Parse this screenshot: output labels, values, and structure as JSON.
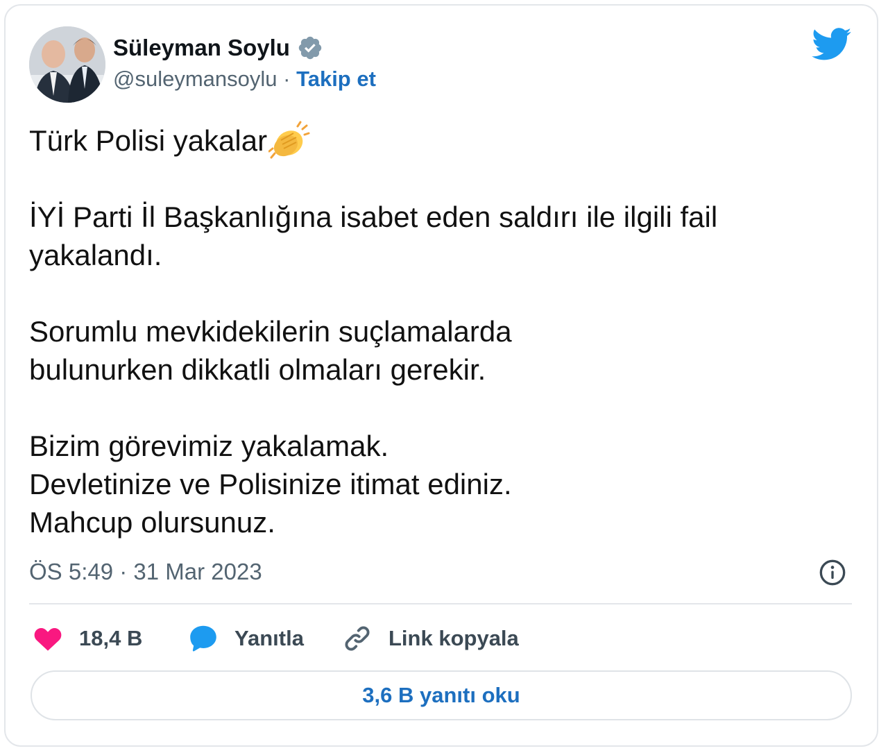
{
  "author": {
    "name": "Süleyman Soylu",
    "handle": "@suleymansoylu",
    "separator": " · ",
    "follow_label": "Takip et",
    "verified_icon": "verified-badge-icon"
  },
  "tweet": {
    "lines": [
      "Türk Polisi yakalar",
      "",
      "İYİ Parti İl Başkanlığına isabet eden saldırı ile ilgili fail",
      "yakalandı.",
      "",
      "Sorumlu mevkidekilerin suçlamalarda",
      "bulunurken dikkatli olmaları gerekir.",
      "",
      "Bizim görevimiz yakalamak.",
      "Devletinize ve Polisinize itimat ediniz.",
      "Mahcup olursunuz."
    ],
    "emoji": "clapping-hands-icon",
    "timestamp": "ÖS 5:49 · 31 Mar 2023"
  },
  "actions": {
    "likes": "18,4 B",
    "reply_label": "Yanıtla",
    "copy_link_label": "Link kopyala"
  },
  "read_replies_label": "3,6 B yanıtı oku",
  "colors": {
    "link_blue": "#1d6fbf",
    "twitter_blue": "#1d9bf0",
    "like_pink": "#f91880",
    "muted": "#536471"
  }
}
